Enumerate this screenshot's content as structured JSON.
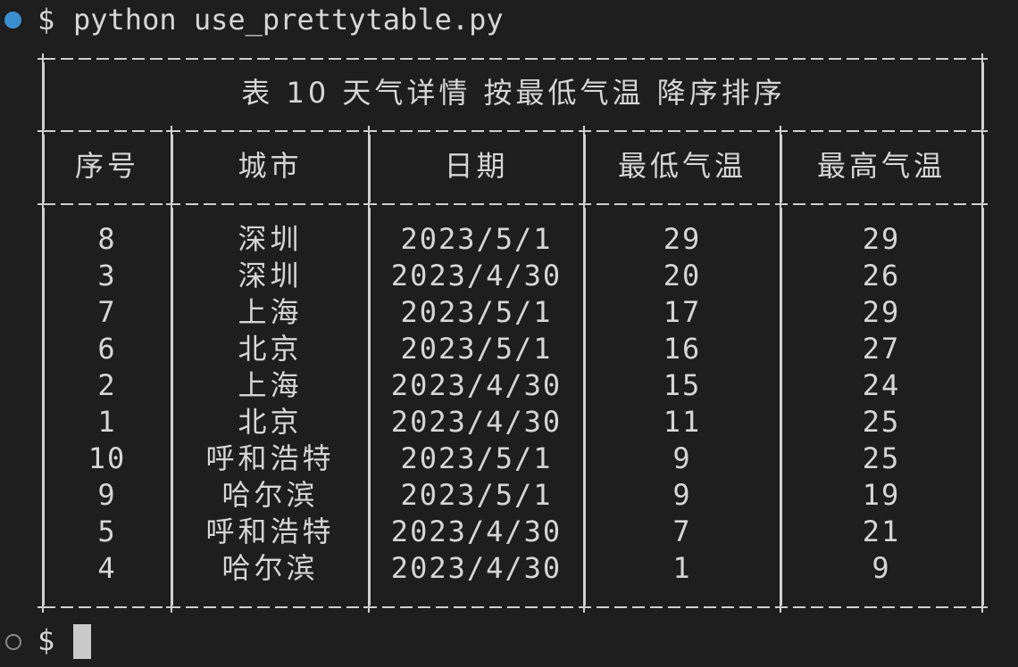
{
  "terminal": {
    "prompt_symbol": "$",
    "command": "python use_prettytable.py",
    "next_prompt_symbol": "$"
  },
  "table": {
    "title": "表 10 天气详情 按最低气温 降序排序",
    "headers": [
      "序号",
      "城市",
      "日期",
      "最低气温",
      "最高气温"
    ],
    "rows": [
      [
        "8",
        "深圳",
        "2023/5/1",
        "29",
        "29"
      ],
      [
        "3",
        "深圳",
        "2023/4/30",
        "20",
        "26"
      ],
      [
        "7",
        "上海",
        "2023/5/1",
        "17",
        "29"
      ],
      [
        "6",
        "北京",
        "2023/5/1",
        "16",
        "27"
      ],
      [
        "2",
        "上海",
        "2023/4/30",
        "15",
        "24"
      ],
      [
        "1",
        "北京",
        "2023/4/30",
        "11",
        "25"
      ],
      [
        "10",
        "呼和浩特",
        "2023/5/1",
        "9",
        "25"
      ],
      [
        "9",
        "哈尔滨",
        "2023/5/1",
        "9",
        "19"
      ],
      [
        "5",
        "呼和浩特",
        "2023/4/30",
        "7",
        "21"
      ],
      [
        "4",
        "哈尔滨",
        "2023/4/30",
        "1",
        "9"
      ]
    ]
  },
  "colors": {
    "background": "#1e1e1e",
    "text": "#d6d6d6",
    "status_dot": "#3a8fd1"
  }
}
